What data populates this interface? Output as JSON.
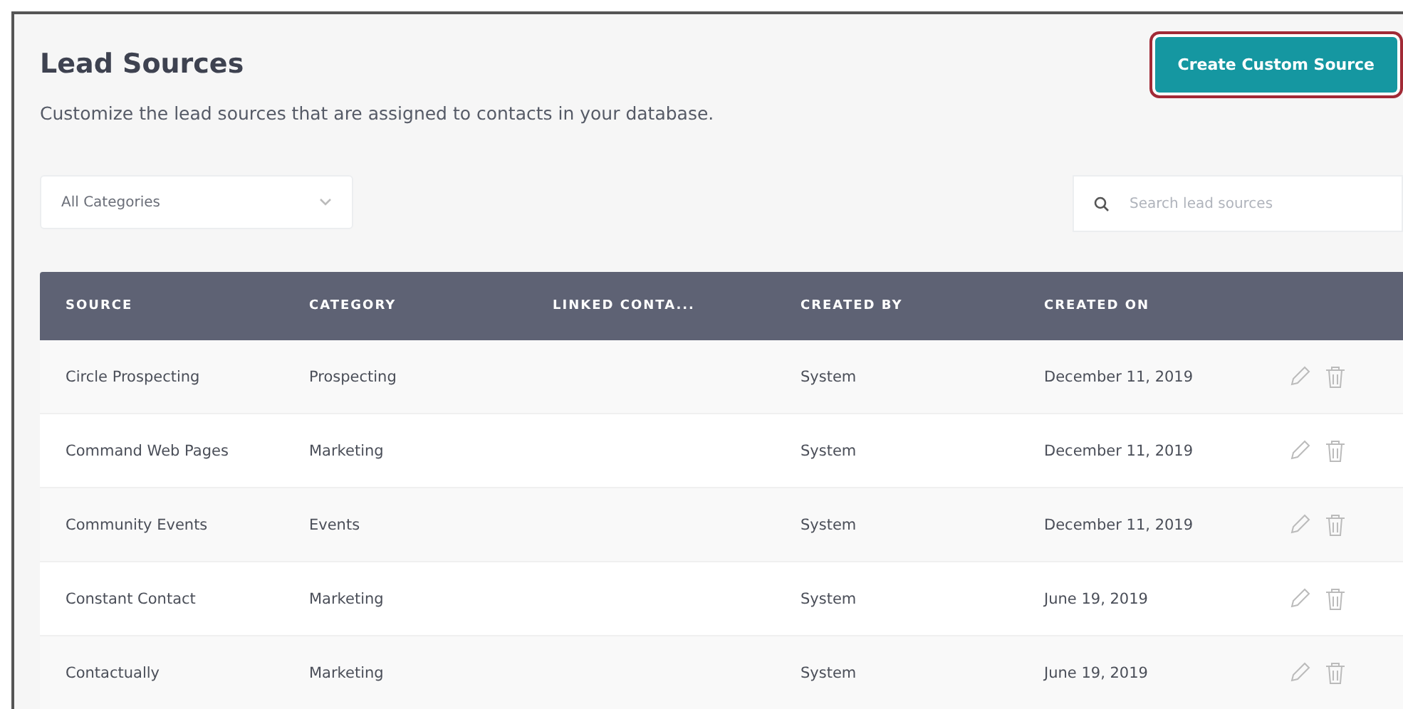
{
  "header": {
    "title": "Lead Sources",
    "subtitle": "Customize the lead sources that are assigned to contacts in your database.",
    "button": "Create Custom Source"
  },
  "filters": {
    "category": "All Categories",
    "search": {
      "placeholder": "Search lead sources"
    }
  },
  "table": {
    "columns": [
      "SOURCE",
      "CATEGORY",
      "LINKED CONTA...",
      "CREATED BY",
      "CREATED ON"
    ],
    "rows": [
      {
        "source": "Circle Prospecting",
        "category": "Prospecting",
        "created_by": "System",
        "created_on": "December 11, 2019"
      },
      {
        "source": "Command Web Pages",
        "category": "Marketing",
        "created_by": "System",
        "created_on": "December 11, 2019"
      },
      {
        "source": "Community Events",
        "category": "Events",
        "created_by": "System",
        "created_on": "December 11, 2019"
      },
      {
        "source": "Constant Contact",
        "category": "Marketing",
        "created_by": "System",
        "created_on": "June 19, 2019"
      },
      {
        "source": "Contactually",
        "category": "Marketing",
        "created_by": "System",
        "created_on": "June 19, 2019"
      }
    ]
  }
}
